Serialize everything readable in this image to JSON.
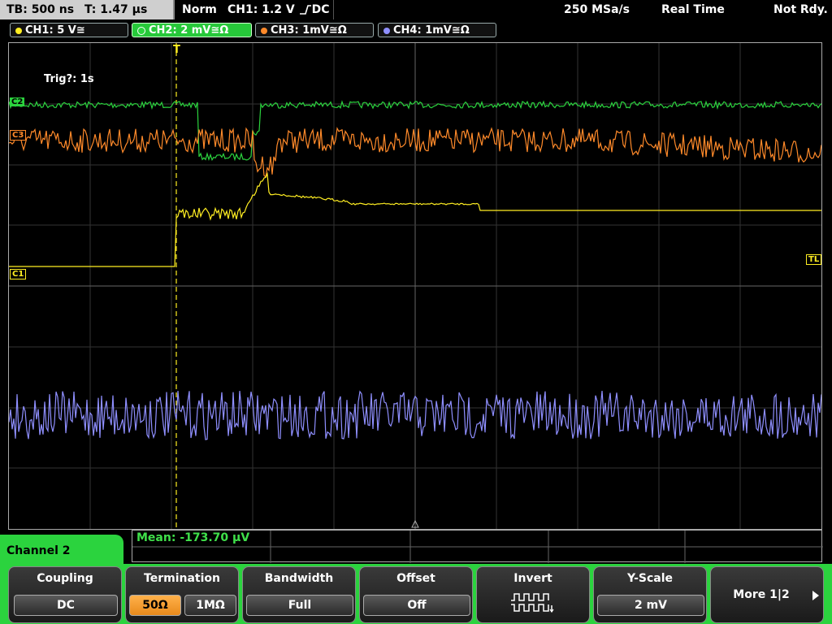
{
  "status": {
    "timebase": "TB: 500 ns",
    "trigger_time": "T: 1.47 µs",
    "mode": "Norm",
    "trigger_setting": "CH1: 1.2 V",
    "trigger_coupling": "DC",
    "sample_rate": "250 MSa/s",
    "acq_mode": "Real Time",
    "ready_state": "Not Rdy."
  },
  "channels": [
    {
      "label": "CH1: 5 V≅",
      "color": "#ffee22"
    },
    {
      "label": "CH2: 2 mV≅Ω",
      "color": "#2bd33e"
    },
    {
      "label": "CH3: 1mV≅Ω",
      "color": "#ff8a2a"
    },
    {
      "label": "CH4: 1mV≅Ω",
      "color": "#8f8fff"
    }
  ],
  "markers": {
    "ch2": "C2",
    "ch3": "C3",
    "ch1": "C1",
    "trigger_level": "TL",
    "trigger_pos": "T"
  },
  "annotation": "Trig?: 1s",
  "measurement": "Mean: -173.70 µV",
  "menu": {
    "channel": "Channel 2",
    "coupling": {
      "title": "Coupling",
      "value": "DC"
    },
    "termination": {
      "title": "Termination",
      "opt1": "50Ω",
      "opt2": "1MΩ"
    },
    "bandwidth": {
      "title": "Bandwidth",
      "value": "Full"
    },
    "offset": {
      "title": "Offset",
      "value": "Off"
    },
    "invert": {
      "title": "Invert"
    },
    "yscale": {
      "title": "Y-Scale",
      "value": "2 mV"
    },
    "more": {
      "label": "More 1|2"
    }
  }
}
